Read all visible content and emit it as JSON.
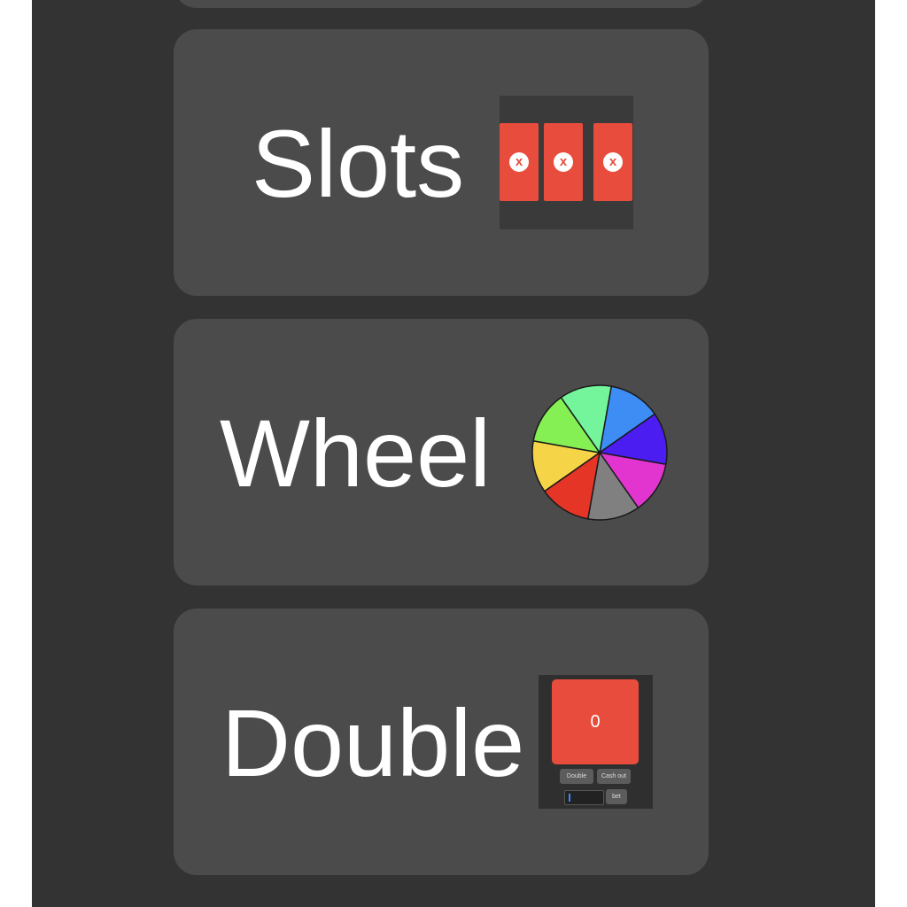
{
  "cards": {
    "slots": {
      "label": "Slots",
      "reel_symbols": [
        "x",
        "x",
        "x"
      ],
      "reel_color": "#e84c3d"
    },
    "wheel": {
      "label": "Wheel",
      "segment_colors": [
        "#3d8df5",
        "#4b1df0",
        "#e235d0",
        "#808080",
        "#e53527",
        "#f5d447",
        "#84f053",
        "#74f59c"
      ]
    },
    "double": {
      "label": "Double",
      "tile_value": "0",
      "tile_color": "#e84c3d",
      "button_double": "Double",
      "button_cashout": "Cash out",
      "button_bet": "bet"
    }
  },
  "colors": {
    "background": "#333333",
    "card": "#4b4b4b",
    "text": "#ffffff"
  }
}
